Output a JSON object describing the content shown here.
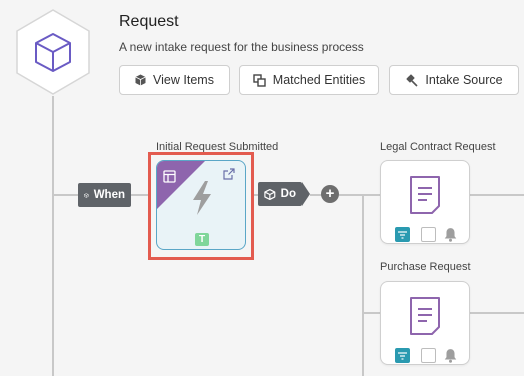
{
  "header": {
    "title": "Request",
    "subtitle": "A new intake request for the business process",
    "buttons": [
      {
        "label": "View Items",
        "icon": "cube-icon"
      },
      {
        "label": "Matched Entities",
        "icon": "overlap-squares-icon"
      },
      {
        "label": "Intake Source",
        "icon": "plug-icon"
      }
    ]
  },
  "flow": {
    "when_label": "When",
    "do_label": "Do",
    "add_symbol": "+",
    "trigger": {
      "label": "Initial Request Submitted",
      "badge": "T",
      "icons": [
        "layout-icon",
        "external-link-icon",
        "lightning-icon"
      ]
    },
    "actions": [
      {
        "label": "Legal Contract Request",
        "icon": "document-icon"
      },
      {
        "label": "Purchase Request",
        "icon": "document-icon"
      }
    ]
  },
  "colors": {
    "accent_purple": "#8e65ad",
    "highlight_red": "#e35b4f",
    "card_border_blue": "#5aa6c7",
    "teal": "#2a9ab0",
    "badge_green": "#7fd69a",
    "pill_gray": "#5f6368"
  }
}
